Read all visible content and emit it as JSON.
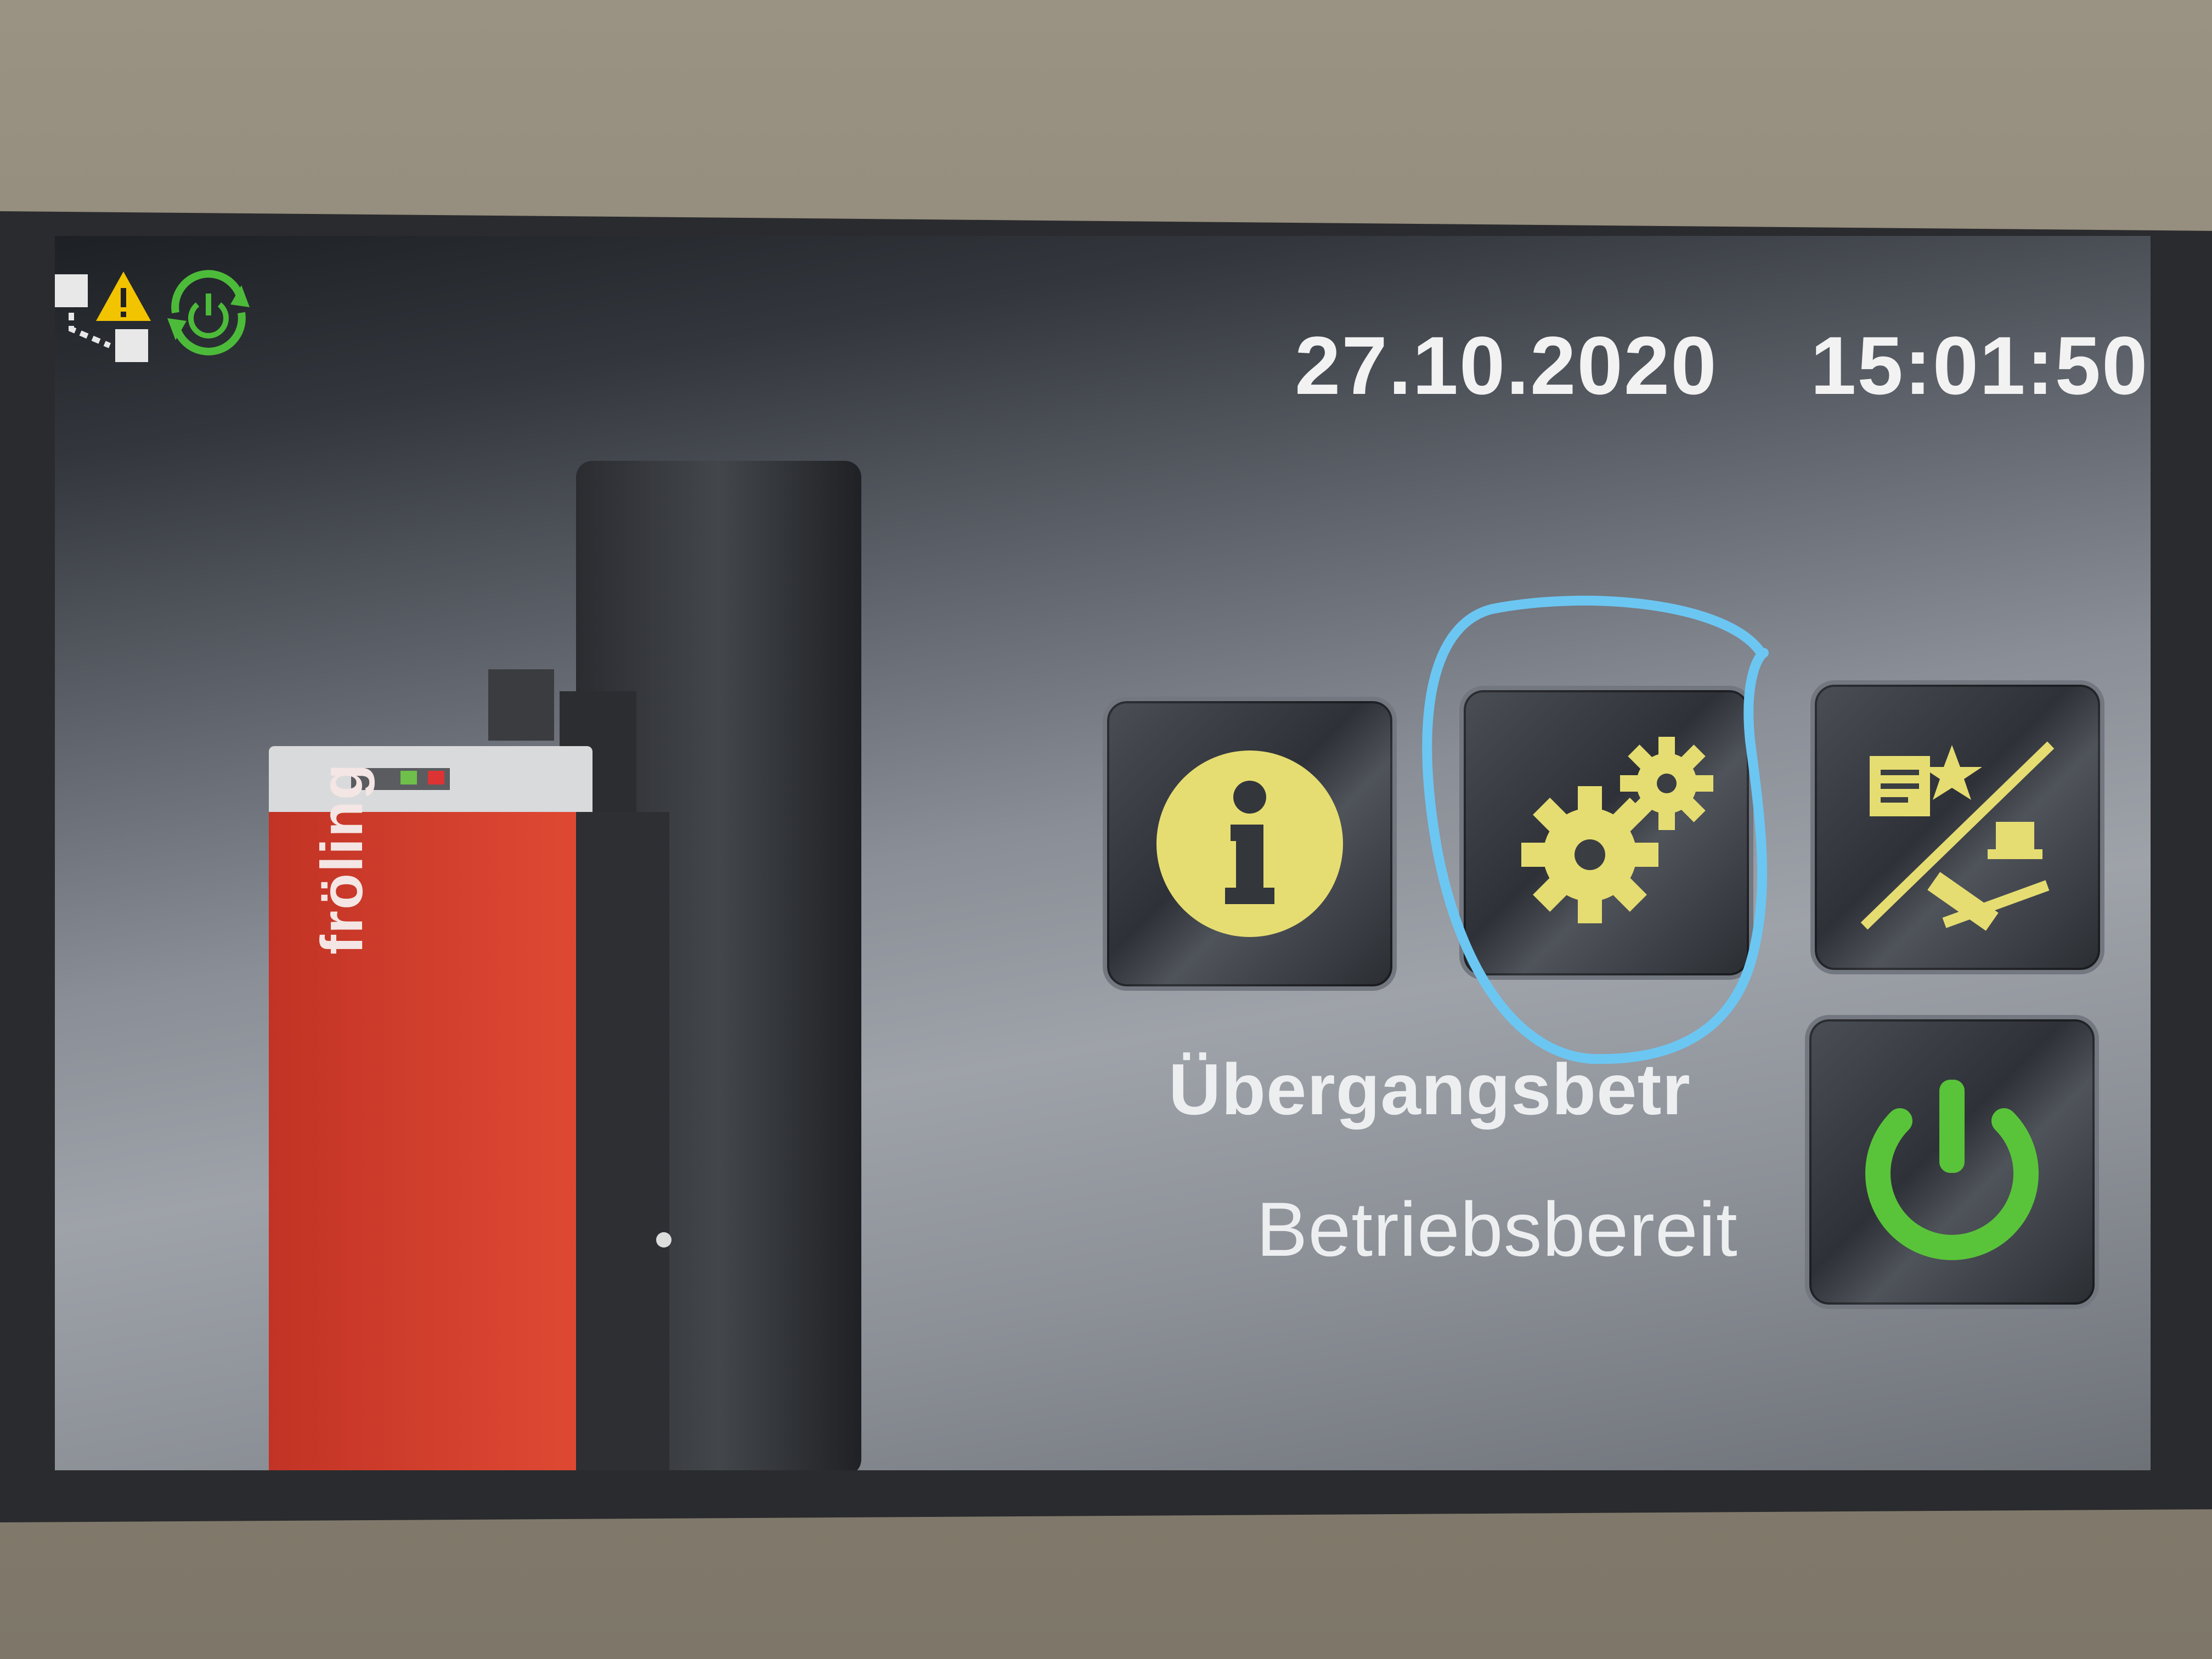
{
  "header": {
    "date": "27.10.2020",
    "time": "15:01:50"
  },
  "boiler": {
    "brand": "fröling"
  },
  "status": {
    "mode": "Übergangsbetr",
    "state": "Betriebsbereit"
  },
  "buttons": {
    "info": {
      "icon": "info-icon"
    },
    "settings": {
      "icon": "gears-icon"
    },
    "sweep": {
      "icon": "chimney-sweep-icon"
    },
    "power": {
      "icon": "power-icon"
    }
  },
  "colors": {
    "icon_yellow": "#e6dd72",
    "power_green": "#59c43a",
    "boiler_red": "#d63a2c",
    "annotation_blue": "#6cc6f2"
  }
}
